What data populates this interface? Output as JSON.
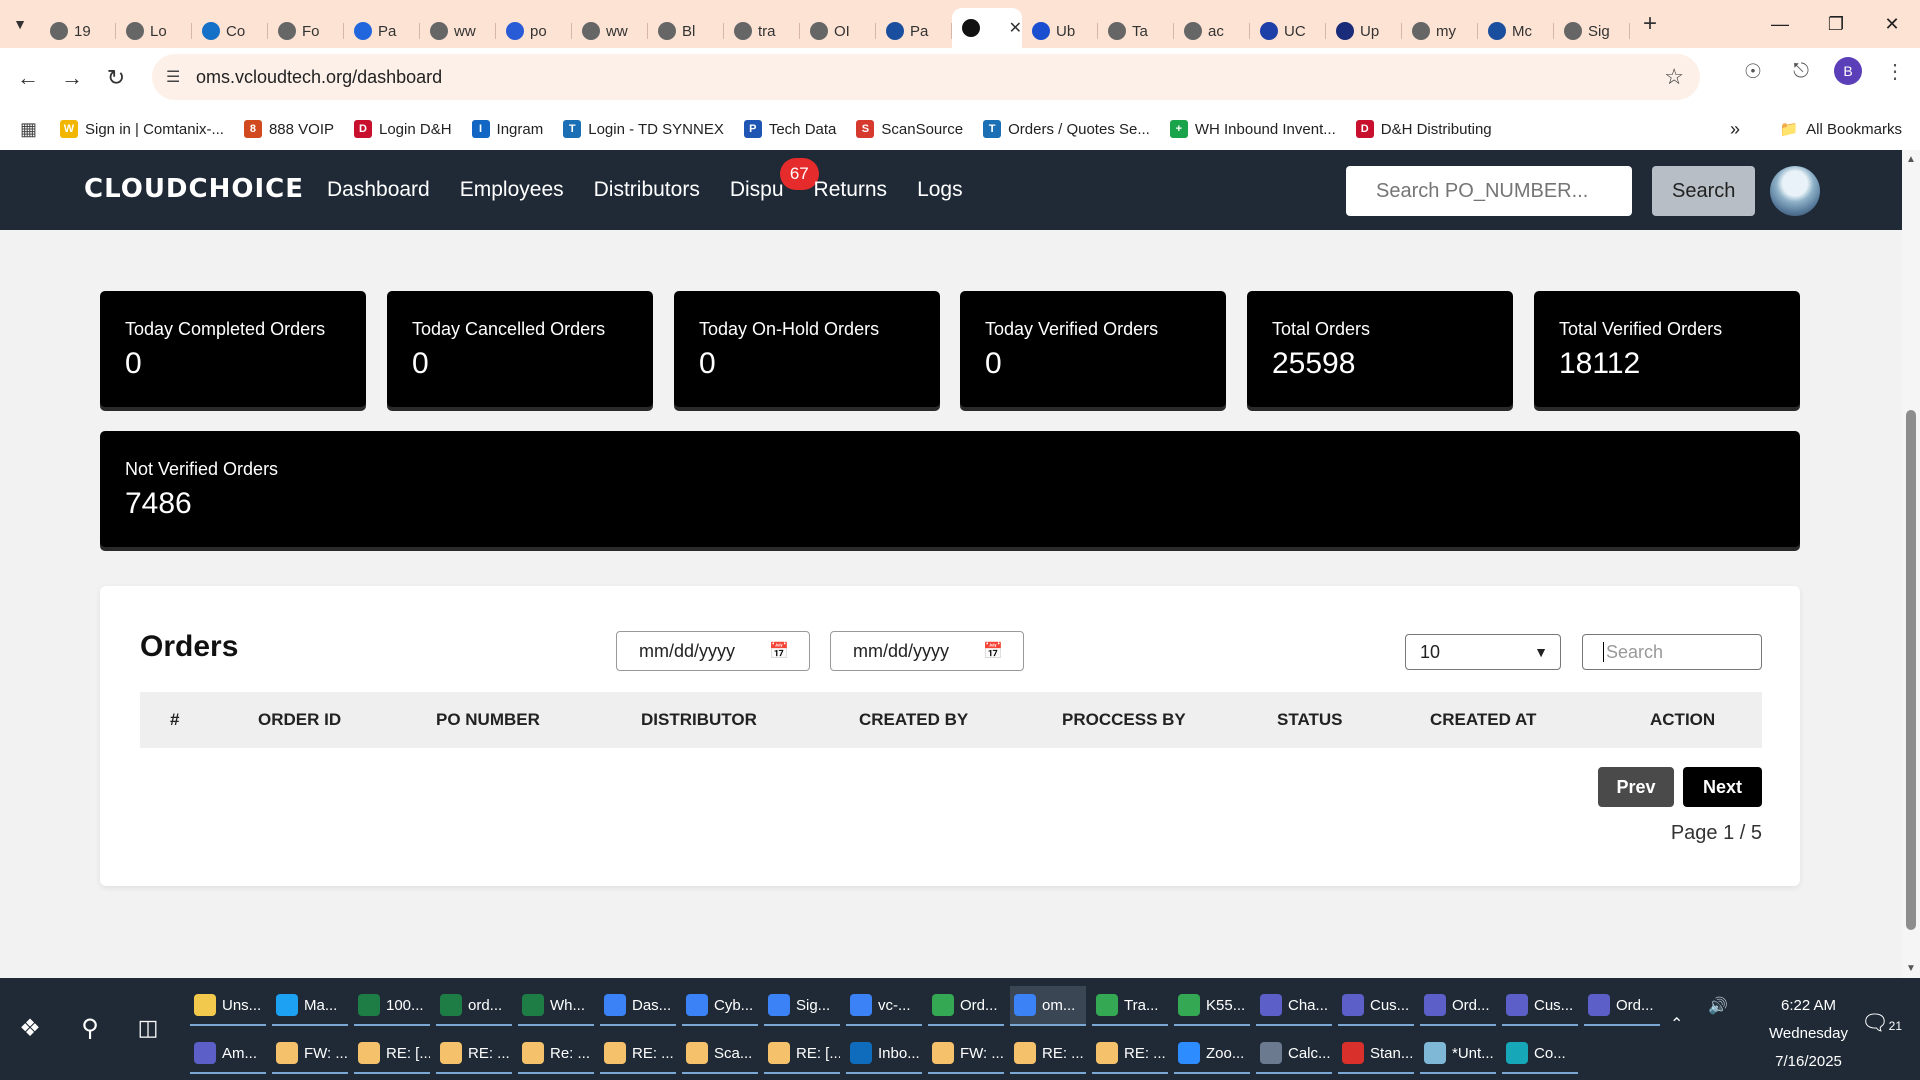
{
  "browser": {
    "tabs": [
      {
        "label": "19",
        "color": "#666"
      },
      {
        "label": "Lo",
        "color": "#666"
      },
      {
        "label": "Co",
        "color": "#1570c7"
      },
      {
        "label": "Fo",
        "color": "#666"
      },
      {
        "label": "Pa",
        "color": "#2266dd"
      },
      {
        "label": "ww",
        "color": "#666"
      },
      {
        "label": "po",
        "color": "#2a5bd7"
      },
      {
        "label": "ww",
        "color": "#666"
      },
      {
        "label": "Bl",
        "color": "#666"
      },
      {
        "label": "tra",
        "color": "#666"
      },
      {
        "label": "OI",
        "color": "#666"
      },
      {
        "label": "Pa",
        "color": "#1a4fa0"
      },
      {
        "label": "",
        "color": "#111"
      },
      {
        "label": "Ub",
        "color": "#1a4fd0"
      },
      {
        "label": "Ta",
        "color": "#666"
      },
      {
        "label": "ac",
        "color": "#666"
      },
      {
        "label": "UC",
        "color": "#1d3fa8"
      },
      {
        "label": "Up",
        "color": "#1a2b7a"
      },
      {
        "label": "my",
        "color": "#666"
      },
      {
        "label": "Mc",
        "color": "#1a4fa0"
      },
      {
        "label": "Sig",
        "color": "#666"
      }
    ],
    "url": "oms.vcloudtech.org/dashboard",
    "profile_initial": "B",
    "bookmarks": [
      {
        "label": "Sign in | Comtanix-...",
        "color": "#f3b600",
        "icon": "W"
      },
      {
        "label": "888 VOIP",
        "color": "#d14a1f",
        "icon": "8"
      },
      {
        "label": "Login D&H",
        "color": "#c8102e",
        "icon": "D"
      },
      {
        "label": "Ingram",
        "color": "#1266c4",
        "icon": "I"
      },
      {
        "label": "Login - TD SYNNEX",
        "color": "#1a6fb5",
        "icon": "T"
      },
      {
        "label": "Tech Data",
        "color": "#1f56b3",
        "icon": "P"
      },
      {
        "label": "ScanSource",
        "color": "#d63a2f",
        "icon": "S"
      },
      {
        "label": "Orders / Quotes Se...",
        "color": "#1a6fb5",
        "icon": "T"
      },
      {
        "label": "WH Inbound Invent...",
        "color": "#19a34a",
        "icon": "+"
      },
      {
        "label": "D&H Distributing",
        "color": "#c8102e",
        "icon": "D"
      }
    ],
    "all_bookmarks": "All Bookmarks"
  },
  "app": {
    "logo": "CLOUDCHOICE",
    "nav": [
      "Dashboard",
      "Employees",
      "Distributors",
      "Dispu",
      "Returns",
      "Logs"
    ],
    "disputes_badge": "67",
    "search_placeholder": "Search PO_NUMBER...",
    "search_button": "Search",
    "stats_row2": [
      {
        "label": "Today Completed Orders",
        "value": "0"
      },
      {
        "label": "Today Cancelled Orders",
        "value": "0"
      },
      {
        "label": "Today On-Hold Orders",
        "value": "0"
      },
      {
        "label": "Today Verified Orders",
        "value": "0"
      },
      {
        "label": "Total Orders",
        "value": "25598"
      },
      {
        "label": "Total Verified Orders",
        "value": "18112"
      }
    ],
    "not_verified": {
      "label": "Not Verified Orders",
      "value": "7486"
    },
    "orders": {
      "title": "Orders",
      "date_placeholder": "mm/dd/yyyy",
      "page_size": "10",
      "search_placeholder": "Search",
      "columns": [
        "#",
        "ORDER ID",
        "PO NUMBER",
        "DISTRIBUTOR",
        "CREATED BY",
        "PROCCESS BY",
        "STATUS",
        "CREATED AT",
        "ACTION"
      ],
      "prev": "Prev",
      "next": "Next",
      "page_info": "Page 1 / 5"
    }
  },
  "taskbar": {
    "row1": [
      {
        "label": "Uns...",
        "color": "#f2c94c"
      },
      {
        "label": "Ma...",
        "color": "#1da1f2"
      },
      {
        "label": "100...",
        "color": "#1e7c45"
      },
      {
        "label": "ord...",
        "color": "#1e7c45"
      },
      {
        "label": "Wh...",
        "color": "#1e7c45"
      },
      {
        "label": "Das...",
        "color": "#3b82f6"
      },
      {
        "label": "Cyb...",
        "color": "#3b82f6"
      },
      {
        "label": "Sig...",
        "color": "#3b82f6"
      },
      {
        "label": "vc-...",
        "color": "#3b82f6"
      },
      {
        "label": "Ord...",
        "color": "#34a853"
      },
      {
        "label": "om...",
        "color": "#3b82f6"
      },
      {
        "label": "Tra...",
        "color": "#34a853"
      },
      {
        "label": "K55...",
        "color": "#34a853"
      },
      {
        "label": "Cha...",
        "color": "#5b5fc7"
      },
      {
        "label": "Cus...",
        "color": "#5b5fc7"
      },
      {
        "label": "Ord...",
        "color": "#5b5fc7"
      },
      {
        "label": "Cus...",
        "color": "#5b5fc7"
      },
      {
        "label": "Ord...",
        "color": "#5b5fc7"
      }
    ],
    "row2": [
      {
        "label": "Am...",
        "color": "#5b5fc7"
      },
      {
        "label": "FW: ...",
        "color": "#f5c26b"
      },
      {
        "label": "RE: [...",
        "color": "#f5c26b"
      },
      {
        "label": "RE: ...",
        "color": "#f5c26b"
      },
      {
        "label": "Re: ...",
        "color": "#f5c26b"
      },
      {
        "label": "RE: ...",
        "color": "#f5c26b"
      },
      {
        "label": "Sca...",
        "color": "#f5c26b"
      },
      {
        "label": "RE: [...",
        "color": "#f5c26b"
      },
      {
        "label": "Inbo...",
        "color": "#0f6cbd"
      },
      {
        "label": "FW: ...",
        "color": "#f5c26b"
      },
      {
        "label": "RE: ...",
        "color": "#f5c26b"
      },
      {
        "label": "RE: ...",
        "color": "#f5c26b"
      },
      {
        "label": "Zoo...",
        "color": "#2d8cff"
      },
      {
        "label": "Calc...",
        "color": "#6b7a8f"
      },
      {
        "label": "Stan...",
        "color": "#d9302c"
      },
      {
        "label": "*Unt...",
        "color": "#7fb8d6"
      },
      {
        "label": "Co...",
        "color": "#16a8b8"
      }
    ],
    "time": "6:22 AM",
    "day": "Wednesday",
    "date": "7/16/2025",
    "notifications": "21"
  }
}
